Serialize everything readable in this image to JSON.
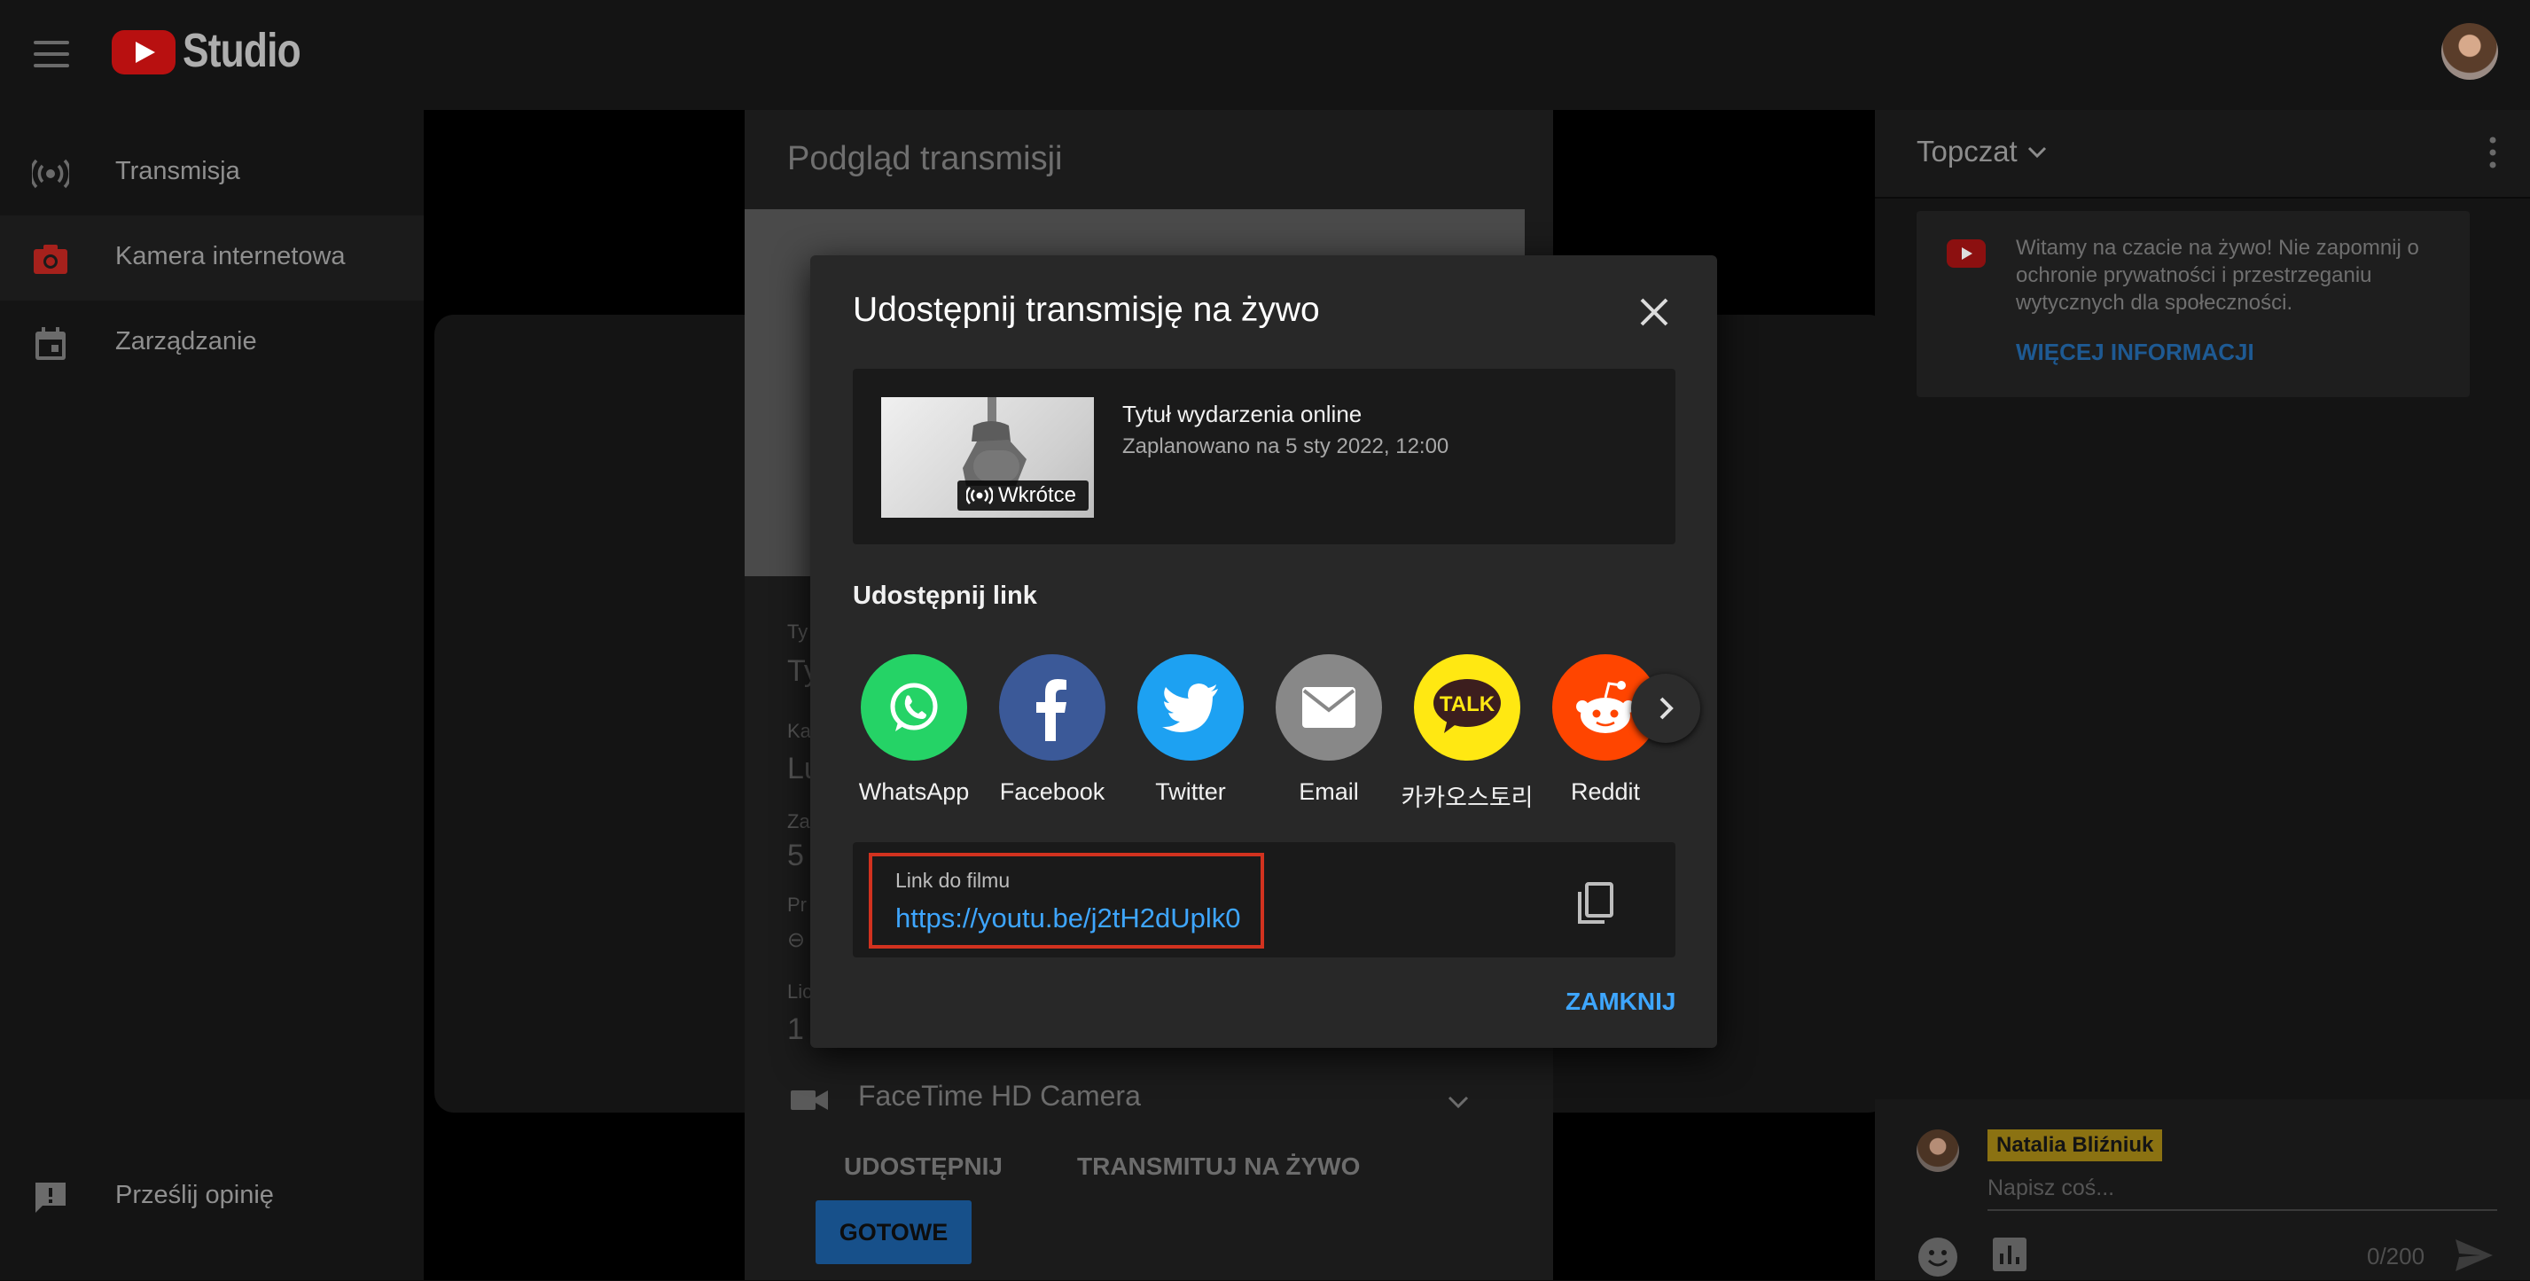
{
  "app": {
    "logo_text": "Studio"
  },
  "sidebar": {
    "items": [
      {
        "label": "Transmisja",
        "icon": "broadcast-icon",
        "active": false
      },
      {
        "label": "Kamera internetowa",
        "icon": "camera-icon",
        "active": true
      },
      {
        "label": "Zarządzanie",
        "icon": "calendar-icon",
        "active": false
      }
    ],
    "feedback_label": "Prześlij opinię"
  },
  "preview": {
    "title": "Podgląd transmisji",
    "camera_label": "FaceTime HD Camera",
    "share_button": "UDOSTĘPNIJ",
    "stream_button": "TRANSMITUJ NA ŻYWO",
    "done_button": "GOTOWE"
  },
  "chat": {
    "title": "Topczat",
    "welcome_text": "Witamy na czacie na żywo! Nie zapomnij o ochronie prywatności i przestrzeganiu wytycznych dla społeczności.",
    "welcome_link": "WIĘCEJ INFORMACJI",
    "user_name": "Natalia Bliźniuk",
    "input_placeholder": "Napisz coś...",
    "char_count": "0/200"
  },
  "modal": {
    "title": "Udostępnij transmisję na żywo",
    "event": {
      "title": "Tytuł wydarzenia online",
      "scheduled": "Zaplanowano na 5 sty 2022, 12:00",
      "badge": "Wkrótce"
    },
    "share_heading": "Udostępnij link",
    "share_targets": [
      {
        "name": "WhatsApp",
        "icon": "whatsapp-icon",
        "color": "#25d366"
      },
      {
        "name": "Facebook",
        "icon": "facebook-icon",
        "color": "#3b5998"
      },
      {
        "name": "Twitter",
        "icon": "twitter-icon",
        "color": "#1da1f2"
      },
      {
        "name": "Email",
        "icon": "email-icon",
        "color": "#888888"
      },
      {
        "name": "카카오스토리",
        "icon": "kakaotalk-icon",
        "color": "#ffe812"
      },
      {
        "name": "Reddit",
        "icon": "reddit-icon",
        "color": "#ff4500"
      }
    ],
    "link_label": "Link do filmu",
    "link_url": "https://youtu.be/j2tH2dUplk0",
    "close_button": "ZAMKNIJ"
  },
  "colors": {
    "accent_link": "#3ea6ff",
    "highlight_border": "#d2321f",
    "youtube_red": "#ff0000"
  }
}
